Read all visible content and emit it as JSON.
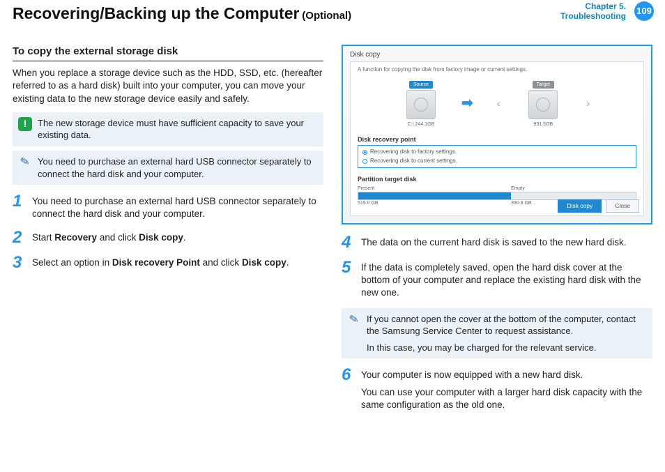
{
  "header": {
    "title": "Recovering/Backing up the Computer",
    "title_optional": "(Optional)",
    "chapter_line1": "Chapter 5.",
    "chapter_line2": "Troubleshooting",
    "page": "109"
  },
  "left": {
    "section_title": "To copy the external storage disk",
    "intro": "When you replace a storage device such as the HDD, SSD, etc. (hereafter referred to as a hard disk) built into your computer, you can move your existing data to the new storage device easily and safely.",
    "callout_excl": "The new storage device must have sufficient capacity to save your existing data.",
    "callout_note": "You need to purchase an external hard USB connector separately to connect the hard disk and your computer.",
    "steps": {
      "s1": "You need to purchase an external hard USB connector separately to connect the hard disk and your computer.",
      "s2_pre": "Start ",
      "s2_b1": "Recovery",
      "s2_mid": " and click ",
      "s2_b2": "Disk copy",
      "s2_post": ".",
      "s3_pre": "Select an option in ",
      "s3_b1": "Disk recovery Point",
      "s3_mid": " and click ",
      "s3_b2": "Disk copy",
      "s3_post": "."
    }
  },
  "right": {
    "dialog": {
      "title": "Disk copy",
      "desc": "A function for copying the disk from factory image or current settings.",
      "source_tag": "Source",
      "target_tag": "Target",
      "source_size": "C:\\ 244.1GB",
      "target_size": "931.5GB",
      "drp_label": "Disk recovery point",
      "opt1": "Recovering disk to factory settings.",
      "opt2": "Recovering disk to current settings.",
      "pt_label": "Partition target disk",
      "pt_present": "Present",
      "pt_empty": "Empty",
      "pt_size_a": "519.0 GB",
      "pt_size_b": "390.8 GB",
      "btn_copy": "Disk copy",
      "btn_close": "Close"
    },
    "steps": {
      "s4": "The data on the current hard disk is saved to the new hard disk.",
      "s5": "If the data is completely saved, open the hard disk cover at the bottom of your computer and replace the existing hard disk with the new one.",
      "note_l1": "If you cannot open the cover at the bottom of the computer, contact the Samsung Service Center to request assistance.",
      "note_l2": "In this case, you may be charged for the relevant service.",
      "s6_a": "Your computer is now equipped with a new hard disk.",
      "s6_b": "You can use your computer with a larger hard disk capacity with the same configuration as the old one."
    }
  },
  "nums": {
    "n1": "1",
    "n2": "2",
    "n3": "3",
    "n4": "4",
    "n5": "5",
    "n6": "6"
  }
}
